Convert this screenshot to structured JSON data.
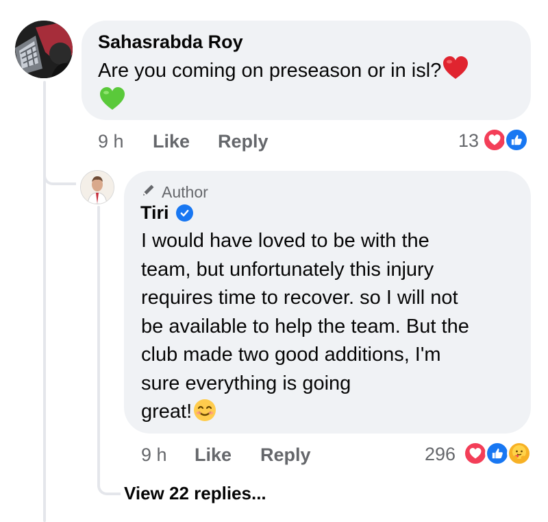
{
  "comment": {
    "author": "Sahasrabda Roy",
    "text": "Are you coming on preseason or in isl?",
    "time": "9 h",
    "like_label": "Like",
    "reply_label": "Reply",
    "reaction_count": "13",
    "reactions": [
      "love",
      "like"
    ]
  },
  "reply": {
    "badge": "Author",
    "author": "Tiri",
    "verified": true,
    "lines": [
      "I would have loved to be with the",
      "team, but unfortunately this injury",
      "requires time to recover. so I will not",
      "be available to help the team. But the",
      "club made two good additions, I'm",
      "sure everything is going",
      "great!"
    ],
    "time": "9 h",
    "like_label": "Like",
    "reply_label": "Reply",
    "reaction_count": "296",
    "reactions": [
      "love",
      "like",
      "care"
    ]
  },
  "view_replies_label": "View 22 replies...",
  "colors": {
    "bubble": "#f0f2f5",
    "meta_text": "#65676b",
    "love": "#f33e58",
    "like": "#1877f2",
    "care": "#f7b125"
  }
}
